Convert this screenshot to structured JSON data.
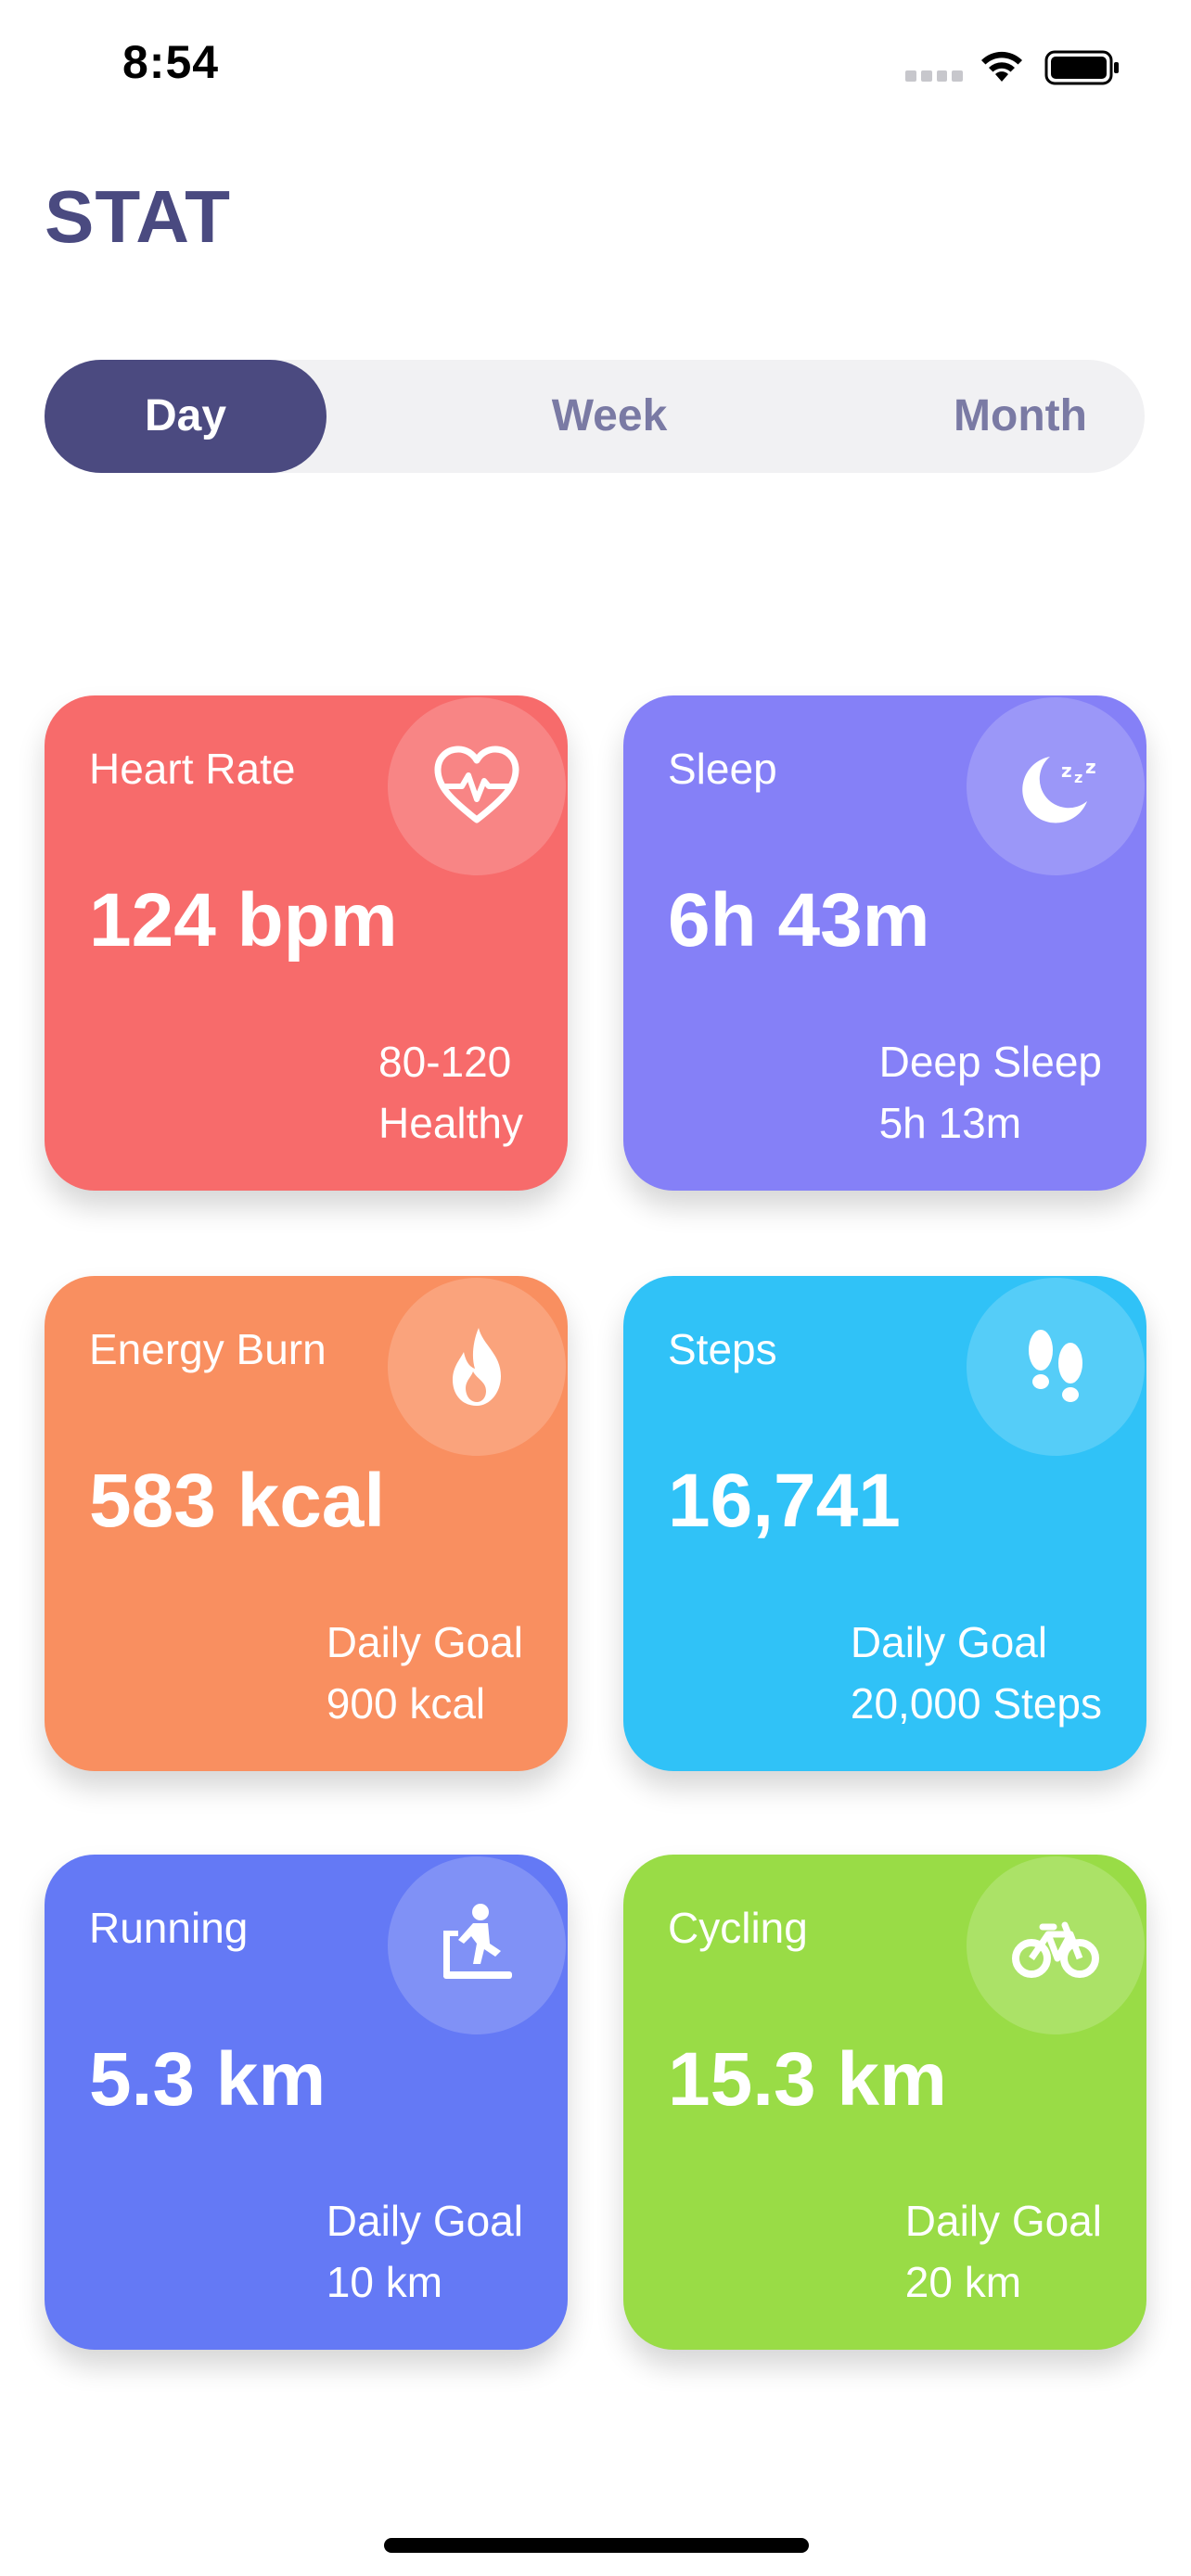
{
  "status_bar": {
    "time": "8:54"
  },
  "header": {
    "title": "STAT"
  },
  "segmented": {
    "items": [
      "Day",
      "Week",
      "Month"
    ],
    "selected": "Day"
  },
  "cards": [
    {
      "label": "Heart Rate",
      "value": "124 bpm",
      "sub_line1": "80-120",
      "sub_line2": "Healthy",
      "icon": "heart-pulse-icon",
      "color": "#f76b6b"
    },
    {
      "label": "Sleep",
      "value": "6h 43m",
      "sub_line1": "Deep Sleep",
      "sub_line2": "5h 13m",
      "icon": "moon-icon",
      "color": "#8580f7"
    },
    {
      "label": "Energy Burn",
      "value": "583 kcal",
      "sub_line1": "Daily Goal",
      "sub_line2": "900 kcal",
      "icon": "flame-icon",
      "color": "#f98f60"
    },
    {
      "label": "Steps",
      "value": "16,741",
      "sub_line1": "Daily Goal",
      "sub_line2": "20,000 Steps",
      "icon": "footsteps-icon",
      "color": "#30c2f7"
    },
    {
      "label": "Running",
      "value": "5.3 km",
      "sub_line1": "Daily Goal",
      "sub_line2": "10 km",
      "icon": "treadmill-icon",
      "color": "#6479f5"
    },
    {
      "label": "Cycling",
      "value": "15.3 km",
      "sub_line1": "Daily Goal",
      "sub_line2": "20 km",
      "icon": "bicycle-icon",
      "color": "#99dc46"
    }
  ]
}
